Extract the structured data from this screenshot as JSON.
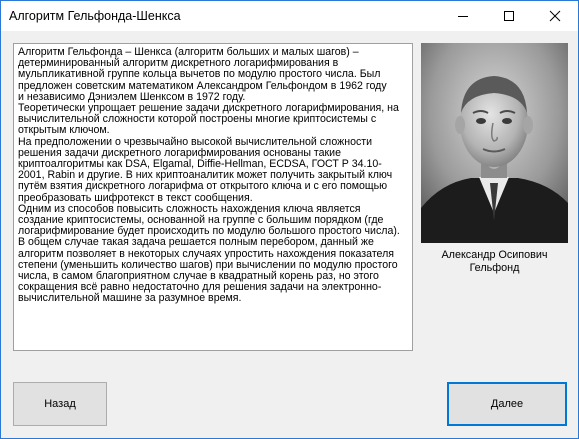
{
  "window": {
    "title": "Алгоритм Гельфонда-Шенкса",
    "controls": [
      "minimize-icon",
      "maximize-icon",
      "close-icon"
    ]
  },
  "description": {
    "text": "Алгоритм Гельфонда – Шенкса (алгоритм больших и малых шагов) –\nдетерминированный алгоритм дискретного логарифмирования в\nмульпликативной группе кольца вычетов по модулю простого числа. Был\nпредложен советским математиком Александром Гельфондом в 1962 году\nи независимо Дэниэлем Шенксом в 1972 году.\nТеоретически упрощает решение задачи дискретного логарифмирования, на\nвычислительной сложности которой построены многие криптосистемы с\nоткрытым ключом.\nНа предположении о чрезвычайно высокой вычислительной сложности\nрешения задачи дискретного логарифмирования  основаны такие\nкриптоалгоритмы как DSA, Elgamal, Diffie-Hellman, ECDSA, ГОСТ Р 34.10-\n2001, Rabin и другие. В них криптоаналитик может получить закрытый ключ\nпутём взятия дискретного логарифма от открытого ключа и с его помощью\nпреобразовать шифротекст в текст сообщения.\nОдним из способов повысить сложность нахождения ключа является\nсоздание криптосистемы, основанной на группе с большим порядком (где\nлогарифмирование будет происходить по модулю большого простого числа).\nВ общем случае такая задача решается полным перебором, данный же\nалгоритм позволяет в некоторых случаях упростить нахождения показателя\nстепени (уменьшить количество шагов) при вычислении по модулю простого\nчисла, в самом благоприятном случае в квадратный корень раз, но этого\nсокращения всё равно недостаточно для решения задачи на электронно-\nвычислительной машине за разумное время."
  },
  "portrait": {
    "caption": "Александр Осипович\nГельфонд"
  },
  "buttons": {
    "back": "Назад",
    "next": "Далее"
  }
}
